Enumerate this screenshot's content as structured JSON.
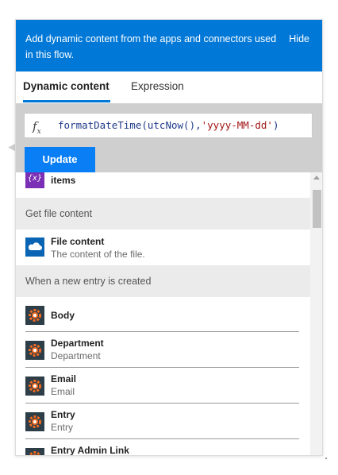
{
  "header": {
    "text": "Add dynamic content from the apps and connectors used in this flow.",
    "hide_label": "Hide"
  },
  "tabs": [
    {
      "label": "Dynamic content",
      "active": true
    },
    {
      "label": "Expression",
      "active": false
    }
  ],
  "expression": {
    "fx_label": "fx",
    "value_prefix": "formatDateTime(utcNow(),",
    "value_string": "'yyyy-MM-dd'",
    "value_suffix": ")",
    "update_label": "Update"
  },
  "list": {
    "top_item": {
      "title": "items",
      "icon": "variable-icon",
      "icon_text": "{x}"
    },
    "sections": [
      {
        "title": "Get file content",
        "items": [
          {
            "title": "File content",
            "subtitle": "The content of the file.",
            "icon": "onedrive-cloud-icon"
          }
        ]
      },
      {
        "title": "When a new entry is created",
        "items": [
          {
            "title": "Body",
            "subtitle": "",
            "icon": "cognito-forms-gear-icon"
          },
          {
            "title": "Department",
            "subtitle": "Department",
            "icon": "cognito-forms-gear-icon"
          },
          {
            "title": "Email",
            "subtitle": "Email",
            "icon": "cognito-forms-gear-icon"
          },
          {
            "title": "Entry",
            "subtitle": "Entry",
            "icon": "cognito-forms-gear-icon"
          },
          {
            "title": "Entry Admin Link",
            "subtitle": "",
            "icon": "cognito-forms-gear-icon"
          }
        ]
      }
    ]
  },
  "colors": {
    "accent": "#0078d7",
    "update_button": "#0a7ff5",
    "variable_icon": "#7a2fb5",
    "onedrive_icon": "#0a64b4",
    "cognito_icon": "#2d3e48",
    "cognito_gear": "#f26a21"
  }
}
